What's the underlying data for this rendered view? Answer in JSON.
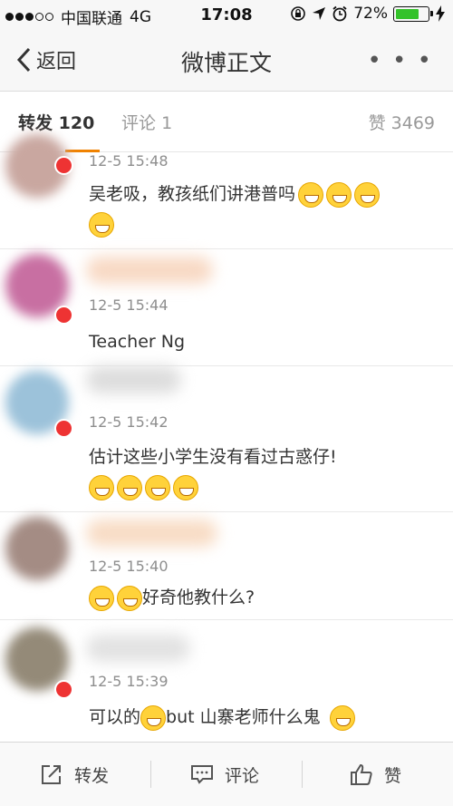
{
  "status_bar": {
    "carrier": "中国联通",
    "network": "4G",
    "time": "17:08",
    "battery": "72%",
    "battery_level": 0.72
  },
  "nav": {
    "back_label": "返回",
    "title": "微博正文",
    "more_label": "• • •"
  },
  "tabs": {
    "repost_label": "转发",
    "repost_count": "120",
    "comment_label": "评论",
    "comment_count": "1",
    "like_label": "赞",
    "like_count": "3469"
  },
  "reposts": [
    {
      "time": "12-5 15:48",
      "text": "吴老吸，教孩纸们讲港普吗"
    },
    {
      "time": "12-5 15:44",
      "text": "Teacher Ng"
    },
    {
      "time": "12-5 15:42",
      "text": "估计这些小学生没有看过古惑仔!"
    },
    {
      "time": "12-5 15:40",
      "text": "好奇他教什么?"
    },
    {
      "time": "12-5 15:39",
      "text_a": "可以的",
      "text_b": "but 山寨老师什么鬼"
    }
  ],
  "toolbar": {
    "repost_label": "转发",
    "comment_label": "评论",
    "like_label": "赞"
  }
}
